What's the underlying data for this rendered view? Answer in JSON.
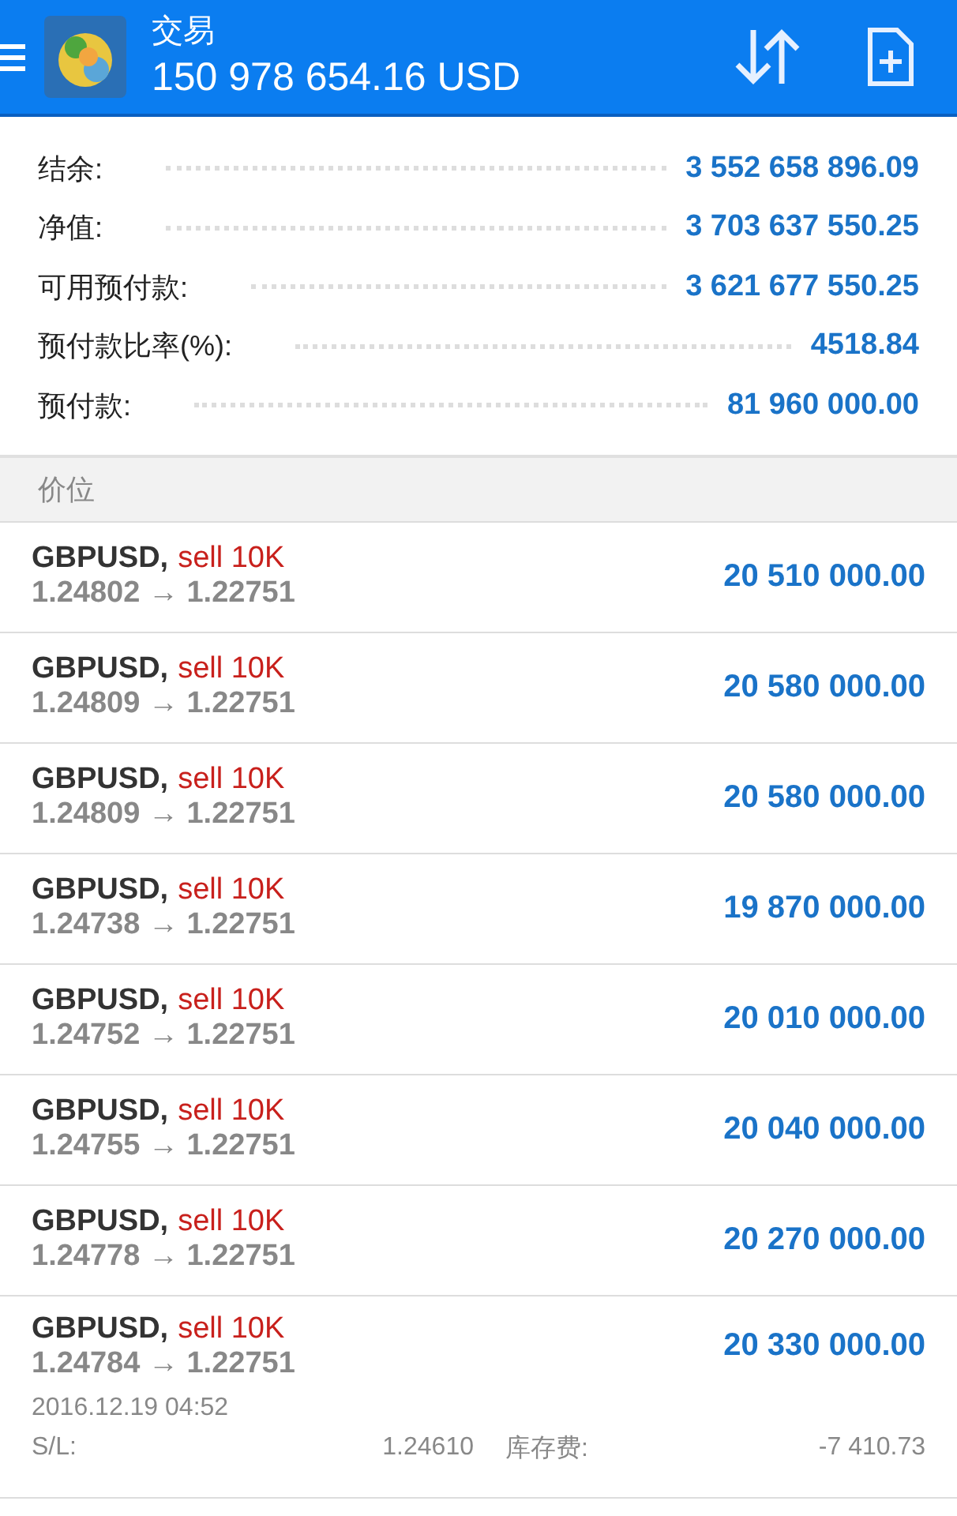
{
  "header": {
    "title": "交易",
    "balance": "150 978 654.16 USD"
  },
  "summary": [
    {
      "label": "结余:",
      "value": "3 552 658 896.09"
    },
    {
      "label": "净值:",
      "value": "3 703 637 550.25"
    },
    {
      "label": "可用预付款:",
      "value": "3 621 677 550.25"
    },
    {
      "label": "预付款比率(%):",
      "value": "4518.84"
    },
    {
      "label": "预付款:",
      "value": "81 960 000.00"
    }
  ],
  "section_title": "价位",
  "positions": [
    {
      "symbol": "GBPUSD,",
      "order": "sell 10K",
      "prices": "1.24802 → 1.22751",
      "profit": "20 510 000.00",
      "expanded": false
    },
    {
      "symbol": "GBPUSD,",
      "order": "sell 10K",
      "prices": "1.24809 → 1.22751",
      "profit": "20 580 000.00",
      "expanded": false
    },
    {
      "symbol": "GBPUSD,",
      "order": "sell 10K",
      "prices": "1.24809 → 1.22751",
      "profit": "20 580 000.00",
      "expanded": false
    },
    {
      "symbol": "GBPUSD,",
      "order": "sell 10K",
      "prices": "1.24738 → 1.22751",
      "profit": "19 870 000.00",
      "expanded": false
    },
    {
      "symbol": "GBPUSD,",
      "order": "sell 10K",
      "prices": "1.24752 → 1.22751",
      "profit": "20 010 000.00",
      "expanded": false
    },
    {
      "symbol": "GBPUSD,",
      "order": "sell 10K",
      "prices": "1.24755 → 1.22751",
      "profit": "20 040 000.00",
      "expanded": false
    },
    {
      "symbol": "GBPUSD,",
      "order": "sell 10K",
      "prices": "1.24778 → 1.22751",
      "profit": "20 270 000.00",
      "expanded": false
    },
    {
      "symbol": "GBPUSD,",
      "order": "sell 10K",
      "prices": "1.24784 → 1.22751",
      "profit": "20 330 000.00",
      "expanded": true,
      "time": "2016.12.19 04:52",
      "sl_label": "S/L:",
      "sl_value": "1.24610",
      "swap_label": "库存费:",
      "swap_value": "-7 410.73"
    }
  ]
}
